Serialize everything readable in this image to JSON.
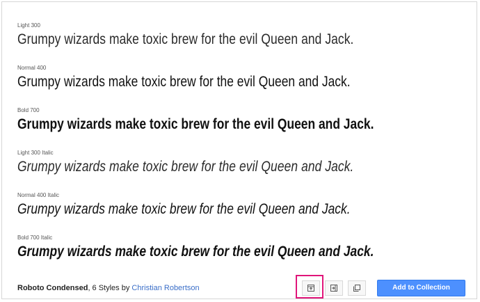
{
  "styles": [
    {
      "label": "Light 300",
      "sample": "Grumpy wizards make toxic brew for the evil Queen and Jack."
    },
    {
      "label": "Normal 400",
      "sample": "Grumpy wizards make toxic brew for the evil Queen and Jack."
    },
    {
      "label": "Bold 700",
      "sample": "Grumpy wizards make toxic brew for the evil Queen and Jack."
    },
    {
      "label": "Light 300 Italic",
      "sample": "Grumpy wizards make toxic brew for the evil Queen and Jack."
    },
    {
      "label": "Normal 400 Italic",
      "sample": "Grumpy wizards make toxic brew for the evil Queen and Jack."
    },
    {
      "label": "Bold 700 Italic",
      "sample": "Grumpy wizards make toxic brew for the evil Queen and Jack."
    }
  ],
  "footer": {
    "family": "Roboto Condensed",
    "styles_text": ", 6 Styles by ",
    "author": "Christian Robertson",
    "view_buttons": [
      {
        "icon": "layout-top-icon"
      },
      {
        "icon": "layout-right-icon"
      },
      {
        "icon": "layout-stack-icon"
      }
    ],
    "add_label": "Add to Collection"
  },
  "colors": {
    "highlight": "#e0157a",
    "primary_button": "#4d90fe",
    "link": "#3a6ec8"
  }
}
